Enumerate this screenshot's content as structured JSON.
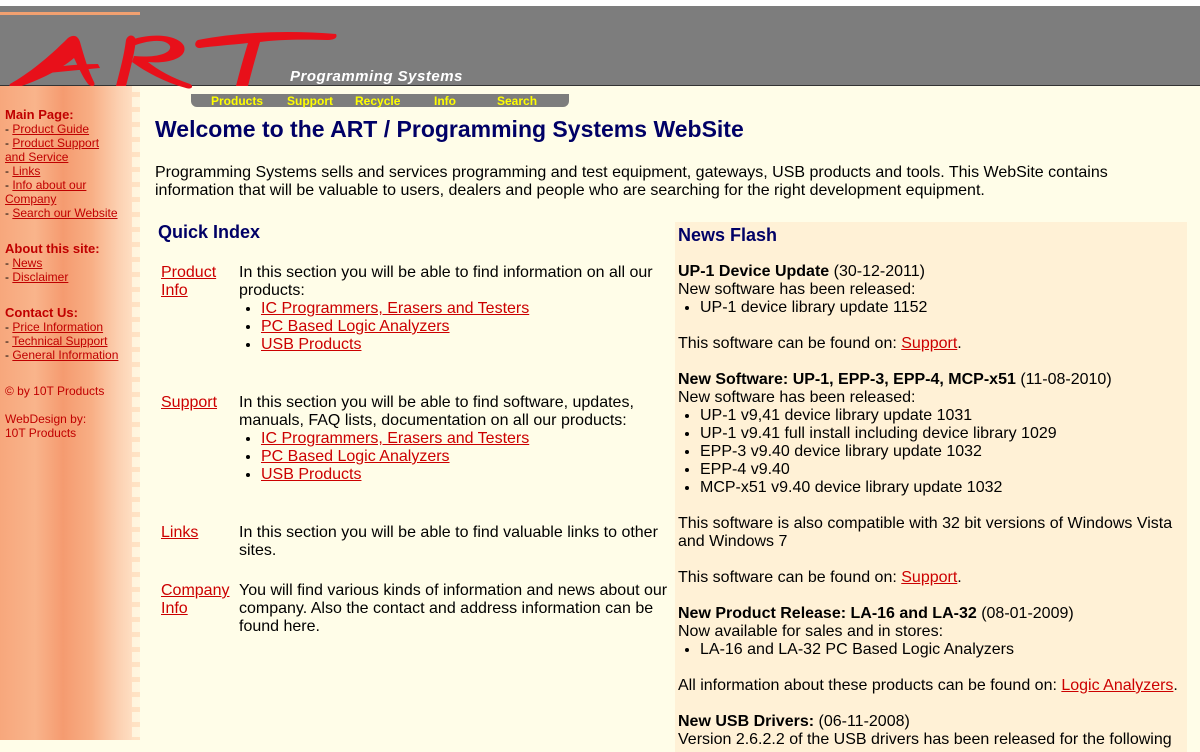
{
  "header": {
    "logo_text": "ART",
    "subtitle": "Programming Systems"
  },
  "sidebar": {
    "main_page": {
      "heading": "Main Page:",
      "items": [
        "Product Guide",
        "Product Support and Service",
        "Links",
        "Info about our Company",
        "Search our Website"
      ]
    },
    "about": {
      "heading": "About this site:",
      "items": [
        "News",
        "Disclaimer"
      ]
    },
    "contact": {
      "heading": "Contact Us:",
      "items": [
        "Price Information",
        "Technical Support",
        "General Information"
      ]
    },
    "copyright": "© by 10T Products",
    "webdesign_line1": "WebDesign by:",
    "webdesign_line2": "10T Products"
  },
  "nav": {
    "items": [
      "Products",
      "Support",
      "Recycle",
      "Info",
      "Search"
    ]
  },
  "main": {
    "title": "Welcome to the ART / Programming Systems WebSite",
    "intro": "Programming Systems sells and services programming and test equipment, gateways, USB products and tools. This WebSite contains information that will be valuable to users, dealers and people who are searching for the right development equipment."
  },
  "quick_index": {
    "title": "Quick Index",
    "rows": [
      {
        "link": "Product Info",
        "text": "In this section you will be able to find information on all our products:",
        "items": [
          "IC Programmers, Erasers and Testers",
          "PC Based Logic Analyzers",
          "USB Products"
        ]
      },
      {
        "link": "Support",
        "text": "In this section you will be able to find software, updates, manuals, FAQ lists, documentation on all our products:",
        "items": [
          "IC Programmers, Erasers and Testers",
          "PC Based Logic Analyzers",
          "USB Products"
        ]
      },
      {
        "link": "Links",
        "text": "In this section you will be able to find valuable links to other sites."
      },
      {
        "link": "Company Info",
        "text": "You will find various kinds of information and news about our company. Also the contact and address information can be found here."
      }
    ]
  },
  "news": {
    "title": "News Flash",
    "item1": {
      "heading": "UP-1 Device Update",
      "date": "(30-12-2011)",
      "line": "New software has been released:",
      "items": [
        "UP-1 device library update 1152"
      ],
      "found_text": "This software can be found on: ",
      "found_link": "Support"
    },
    "item2": {
      "heading": "New Software: UP-1, EPP-3, EPP-4, MCP-x51",
      "date": "(11-08-2010)",
      "line": "New software has been released:",
      "items": [
        "UP-1 v9,41 device library update 1031",
        "UP-1 v9.41 full install including device library 1029",
        "EPP-3 v9.40 device library update 1032",
        "EPP-4 v9.40",
        "MCP-x51 v9.40 device library update 1032"
      ],
      "compat": "This software is also compatible with 32 bit versions of Windows Vista and Windows 7",
      "found_text": "This software can be found on: ",
      "found_link": "Support"
    },
    "item3": {
      "heading": "New Product Release: LA-16 and LA-32",
      "date": "(08-01-2009)",
      "line": "Now available for sales and in stores:",
      "items": [
        "LA-16 and LA-32 PC Based Logic Analyzers"
      ],
      "found_text": "All information about these products can be found on: ",
      "found_link": "Logic Analyzers"
    },
    "item4": {
      "heading": "New USB Drivers:",
      "date": "(06-11-2008)",
      "line": "Version 2.6.2.2 of the USB drivers has been released for the following"
    }
  },
  "colors": {
    "header_bg": "#7d7d7d",
    "logo": "#e8101a",
    "title": "#000066",
    "link": "#cc0000",
    "nav_text": "#ffff00",
    "page_bg": "#fffde8",
    "news_bg": "#fff1d6"
  }
}
